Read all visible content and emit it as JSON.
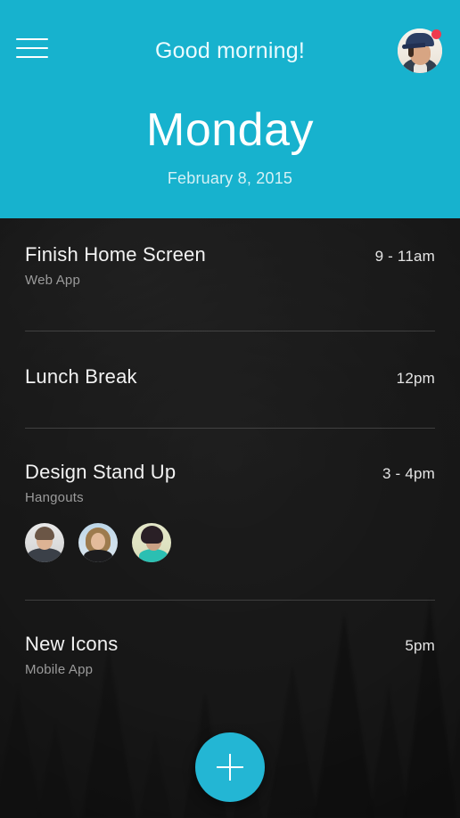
{
  "header": {
    "greeting": "Good morning!",
    "day": "Monday",
    "date": "February 8, 2015",
    "menu_icon": "hamburger-menu-icon",
    "avatar_icon": "user-avatar",
    "notification_badge": "",
    "background_color": "#17b2ce"
  },
  "accent_color": "#23b6d4",
  "body_background_color": "#262626",
  "tasks": [
    {
      "title": "Finish Home Screen",
      "subtitle": "Web App",
      "time": "9 - 11am",
      "attendees": []
    },
    {
      "title": "Lunch Break",
      "subtitle": "",
      "time": "12pm",
      "attendees": []
    },
    {
      "title": "Design Stand Up",
      "subtitle": "Hangouts",
      "time": "3 - 4pm",
      "attendees": [
        "attendee-avatar-1",
        "attendee-avatar-2",
        "attendee-avatar-3"
      ]
    },
    {
      "title": "New Icons",
      "subtitle": "Mobile App",
      "time": "5pm",
      "attendees": []
    }
  ],
  "fab": {
    "label": "+",
    "icon": "plus-icon",
    "color": "#23b6d4"
  }
}
